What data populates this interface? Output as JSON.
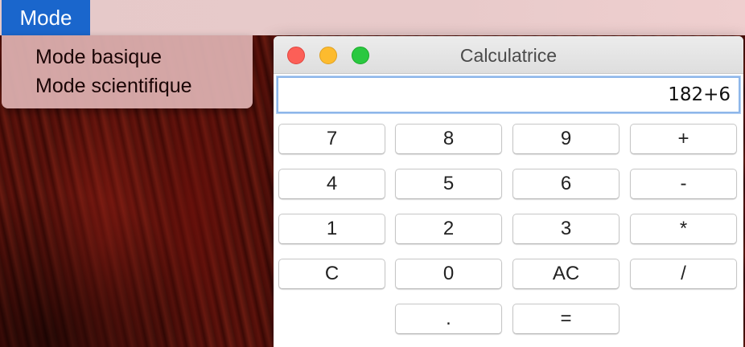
{
  "menubar": {
    "mode_label": "Mode"
  },
  "dropdown": {
    "items": [
      {
        "label": "Mode basique"
      },
      {
        "label": "Mode scientifique"
      }
    ]
  },
  "window": {
    "title": "Calculatrice",
    "display_value": "182+6"
  },
  "keypad": {
    "rows": [
      [
        "7",
        "8",
        "9",
        "+"
      ],
      [
        "4",
        "5",
        "6",
        "-"
      ],
      [
        "1",
        "2",
        "3",
        "*"
      ],
      [
        "C",
        "0",
        "AC",
        "/"
      ],
      [
        ".",
        "="
      ]
    ]
  },
  "colors": {
    "menu_highlight": "#1a66cc",
    "close": "#fc5f57",
    "minimize": "#fdbb2e",
    "maximize": "#2ac840",
    "display_focus_ring": "#8db6ea"
  }
}
